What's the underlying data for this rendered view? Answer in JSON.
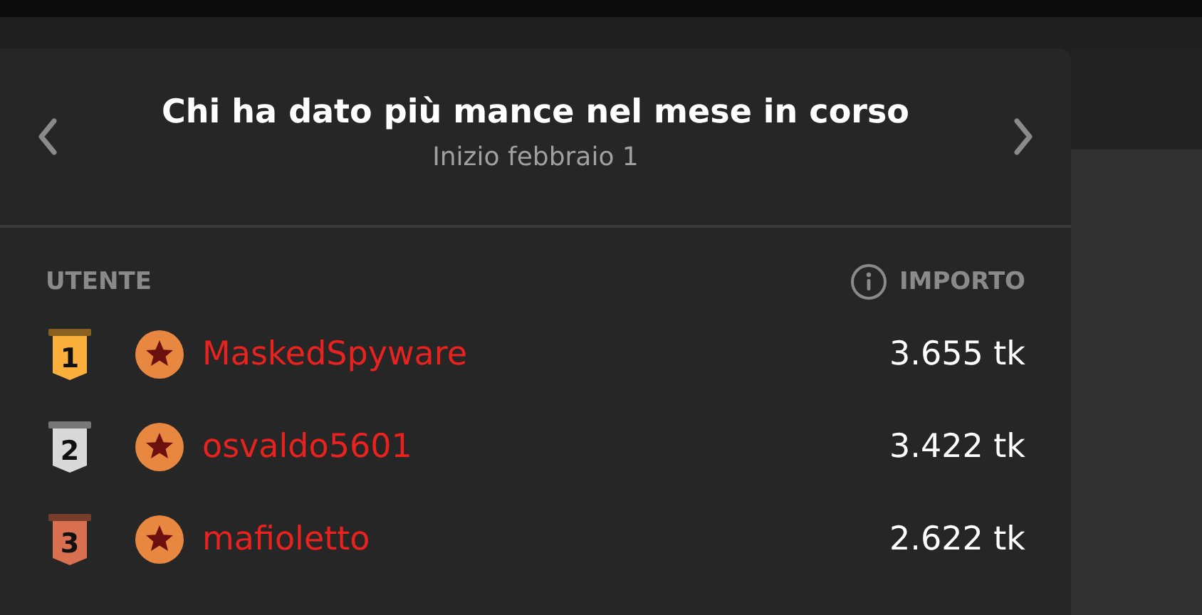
{
  "header": {
    "title": "Chi ha dato più mance nel mese in corso",
    "subtitle": "Inizio febbraio 1"
  },
  "columns": {
    "user": "UTENTE",
    "amount": "IMPORTO"
  },
  "rows": [
    {
      "rank": "1",
      "color": "#fbb03b",
      "user": "MaskedSpyware",
      "amount": "3.655 tk"
    },
    {
      "rank": "2",
      "color": "#d9d9d9",
      "user": "osvaldo5601",
      "amount": "3.422 tk"
    },
    {
      "rank": "3",
      "color": "#d9704f",
      "user": "mafioletto",
      "amount": "2.622 tk"
    }
  ]
}
